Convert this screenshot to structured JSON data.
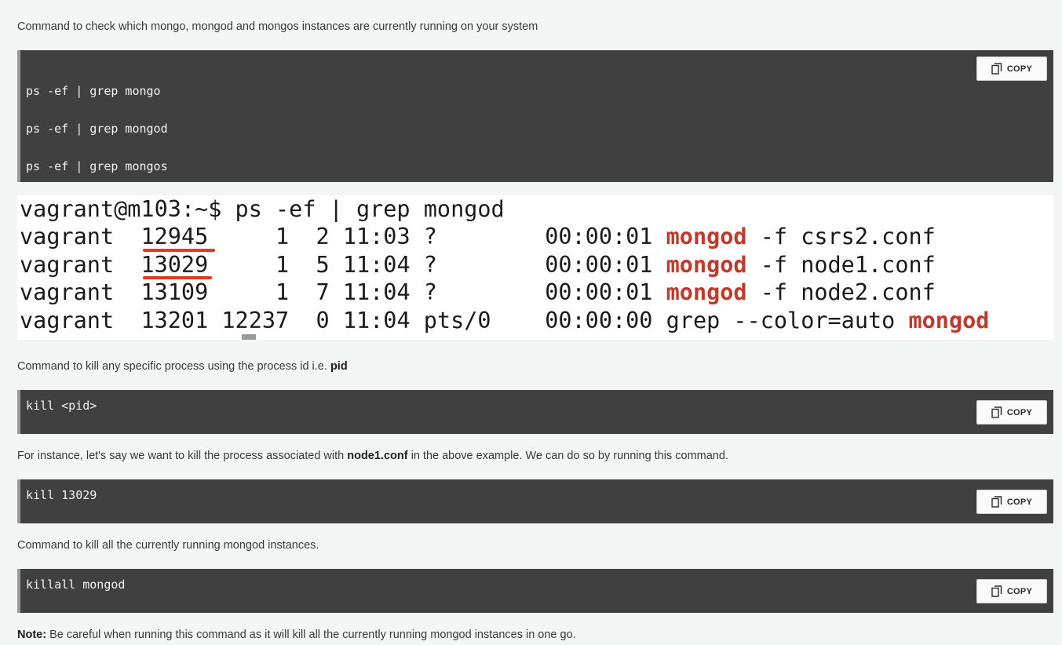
{
  "intro_text": "Command to check which mongo, mongod and mongos instances are currently running on your system",
  "block1": {
    "lines": [
      "ps -ef | grep mongo",
      "ps -ef | grep mongod",
      "ps -ef | grep mongos"
    ],
    "copy_label": "COPY"
  },
  "terminal": {
    "prompt": "vagrant@m103:~$ ps -ef | grep mongod",
    "rows": [
      {
        "pre": "vagrant  ",
        "pid": "12945",
        "mid": "     1  2 11:03 ?        00:00:01 ",
        "hl": "mongod",
        "post": " -f csrs2.conf"
      },
      {
        "pre": "vagrant  ",
        "pid": "13029",
        "mid": "     1  5 11:04 ?        00:00:01 ",
        "hl": "mongod",
        "post": " -f node1.conf"
      },
      {
        "pre": "vagrant  ",
        "pid": "13109",
        "mid": "     1  7 11:04 ?        00:00:01 ",
        "hl": "mongod",
        "post": " -f node2.conf"
      },
      {
        "pre": "vagrant  ",
        "pid": "13201",
        "mid": " 12237  0 11:04 pts/0    00:00:00 grep --color=auto ",
        "hl": "mongod",
        "post": ""
      }
    ]
  },
  "kill_intro": {
    "text": "Command to kill any specific process using the process id i.e. ",
    "bold": "pid"
  },
  "block2": {
    "line": "kill <pid>",
    "copy_label": "COPY"
  },
  "instance_text": {
    "before": "For instance, let's say we want to kill the process associated with ",
    "bold": "node1.conf",
    "after": " in the above example. We can do so by running this command."
  },
  "block3": {
    "line": "kill 13029",
    "copy_label": "COPY"
  },
  "killall_text": "Command to kill all the currently running mongod instances.",
  "block4": {
    "line": "killall mongod",
    "copy_label": "COPY"
  },
  "note": {
    "label": "Note:",
    "text": " Be careful when running this command as it will kill all the currently running mongod instances in one go."
  },
  "colors": {
    "code_bg": "#404040",
    "highlight": "#c0392b",
    "underline": "#e8371e",
    "page_bg": "#f4f5f5"
  }
}
